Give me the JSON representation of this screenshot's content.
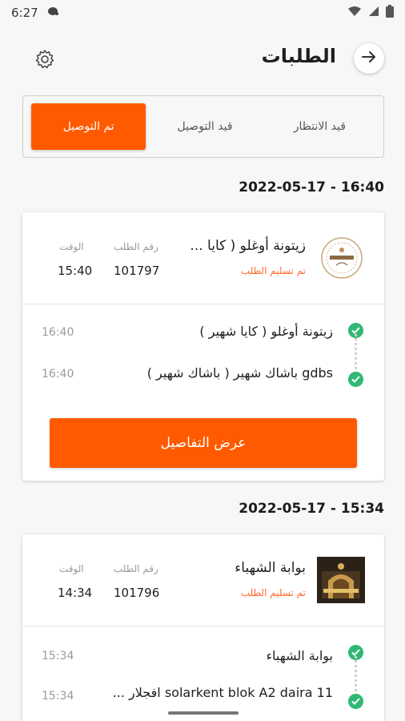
{
  "status_bar": {
    "time": "6:27"
  },
  "header": {
    "title": "الطلبات"
  },
  "tabs": [
    {
      "label": "قيد الانتظار",
      "active": false
    },
    {
      "label": "قيد التوصيل",
      "active": false
    },
    {
      "label": "تم التوصيل",
      "active": true
    }
  ],
  "orders": [
    {
      "date": "2022-05-17 - 16:40",
      "store_name": "زيتونة أوغلو ( كايا ...",
      "status": "تم تسليم الطلب",
      "order_number_label": "رقم الطلب",
      "order_number": "101797",
      "time_label": "الوقت",
      "time": "15:40",
      "pickup": "زيتونة أوغلو ( كايا شهير )",
      "pickup_time": "16:40",
      "dropoff": "gdbs باشاك شهير ( باشاك شهير )",
      "dropoff_time": "16:40",
      "details_button": "عرض التفاصيل"
    },
    {
      "date": "2022-05-17 - 15:34",
      "store_name": "بوابة الشهباء",
      "status": "تم تسليم الطلب",
      "order_number_label": "رقم الطلب",
      "order_number": "101796",
      "time_label": "الوقت",
      "time": "14:34",
      "pickup": "بوابة الشهباء",
      "pickup_time": "15:34",
      "dropoff": "solarkent blok A2 daira 11 افجلار ...",
      "dropoff_time": "15:34"
    }
  ],
  "colors": {
    "accent": "#ff5a00",
    "check": "#2eb872",
    "status_text": "#ff6a2b"
  }
}
